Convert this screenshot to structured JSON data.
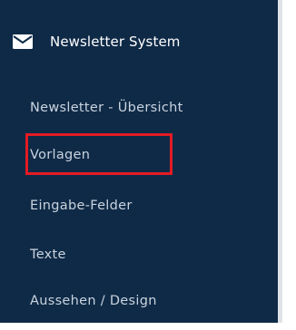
{
  "sidebar": {
    "header": {
      "icon": "envelope-icon",
      "title": "Newsletter System"
    },
    "items": [
      {
        "label": "Newsletter - Übersicht"
      },
      {
        "label": "Vorlagen"
      },
      {
        "label": "Eingabe-Felder"
      },
      {
        "label": "Texte"
      },
      {
        "label": "Aussehen / Design"
      }
    ]
  },
  "colors": {
    "background": "#0f2a47",
    "text": "#c9d3de",
    "header_text": "#ffffff",
    "highlight_border": "#e31b23",
    "scrollbar": "#dfe3e8"
  }
}
